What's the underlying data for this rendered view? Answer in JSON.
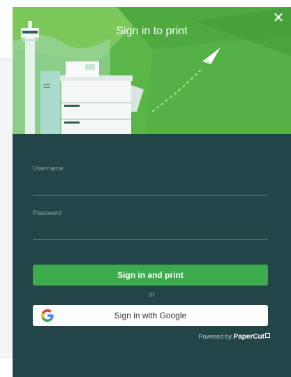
{
  "modal": {
    "title": "Sign in to print",
    "close_symbol": "✕"
  },
  "form": {
    "username_label": "Username",
    "username_value": "",
    "password_label": "Password",
    "password_value": "",
    "signin_button": "Sign in and print",
    "or_text": "or",
    "google_button": "Sign in with Google"
  },
  "footer": {
    "powered_prefix": "Powered by",
    "brand": "PaperCut"
  },
  "colors": {
    "panel_bg": "#234548",
    "primary_green": "#3cab4b",
    "hero_green": "#5db84a"
  }
}
